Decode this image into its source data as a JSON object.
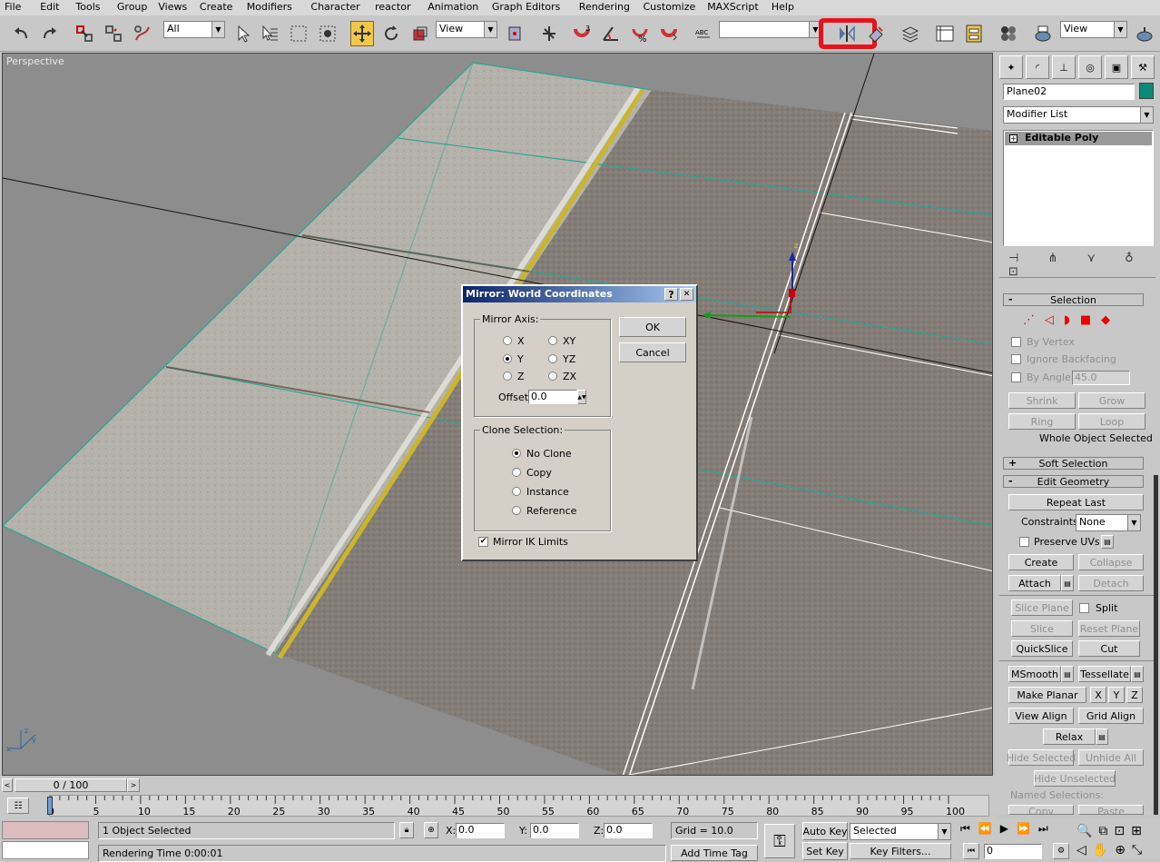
{
  "menu": [
    "File",
    "Edit",
    "Tools",
    "Group",
    "Views",
    "Create",
    "Modifiers",
    "Character",
    "reactor",
    "Animation",
    "Graph Editors",
    "Rendering",
    "Customize",
    "MAXScript",
    "Help"
  ],
  "toolbar": {
    "selection_filter": "All",
    "ref_coord": "View",
    "named_selection": "",
    "render_view": "View"
  },
  "highlight_color": "#e8121c",
  "viewport": {
    "label": "Perspective"
  },
  "dialog": {
    "title": "Mirror: World Coordinates",
    "help": "?",
    "close": "✕",
    "mirror_axis_label": "Mirror Axis:",
    "axes": [
      {
        "label": "X",
        "selected": false
      },
      {
        "label": "Y",
        "selected": true
      },
      {
        "label": "Z",
        "selected": false
      },
      {
        "label": "XY",
        "selected": false
      },
      {
        "label": "YZ",
        "selected": false
      },
      {
        "label": "ZX",
        "selected": false
      }
    ],
    "offset_label": "Offset:",
    "offset_value": "0.0",
    "clone_label": "Clone Selection:",
    "clone_options": [
      {
        "label": "No Clone",
        "selected": true
      },
      {
        "label": "Copy",
        "selected": false
      },
      {
        "label": "Instance",
        "selected": false
      },
      {
        "label": "Reference",
        "selected": false
      }
    ],
    "mirror_ik_label": "Mirror IK Limits",
    "mirror_ik_checked": true,
    "ok": "OK",
    "cancel": "Cancel"
  },
  "panel": {
    "object_name": "Plane02",
    "object_color": "#0a8a78",
    "modifier_list": "Modifier List",
    "stack_item": "Editable Poly",
    "selection_head": "Selection",
    "by_vertex": "By Vertex",
    "ignore_backfacing": "Ignore Backfacing",
    "by_angle": "By Angle:",
    "by_angle_value": "45.0",
    "shrink": "Shrink",
    "grow": "Grow",
    "ring": "Ring",
    "loop": "Loop",
    "whole_object": "Whole Object Selected",
    "soft_selection": "Soft Selection",
    "edit_geometry": "Edit Geometry",
    "repeat_last": "Repeat Last",
    "constraints_label": "Constraints:",
    "constraints_value": "None",
    "preserve_uvs": "Preserve UVs",
    "create": "Create",
    "collapse": "Collapse",
    "attach": "Attach",
    "detach": "Detach",
    "slice_plane": "Slice Plane",
    "split": "Split",
    "slice": "Slice",
    "reset_plane": "Reset Plane",
    "quickslice": "QuickSlice",
    "cut": "Cut",
    "msmooth": "MSmooth",
    "tessellate": "Tessellate",
    "make_planar": "Make Planar",
    "x": "X",
    "y": "Y",
    "z": "Z",
    "view_align": "View Align",
    "grid_align": "Grid Align",
    "relax": "Relax",
    "hide_selected": "Hide Selected",
    "unhide_all": "Unhide All",
    "hide_unselected": "Hide Unselected",
    "named_selections": "Named Selections:",
    "copy": "Copy",
    "paste": "Paste"
  },
  "timeline": {
    "frame": "0 / 100",
    "ticks": [
      "0",
      "5",
      "10",
      "15",
      "20",
      "25",
      "30",
      "35",
      "40",
      "45",
      "50",
      "55",
      "60",
      "65",
      "70",
      "75",
      "80",
      "85",
      "90",
      "95",
      "100"
    ]
  },
  "status": {
    "selected": "1 Object Selected",
    "render_time": "Rendering Time  0:00:01",
    "x_label": "X:",
    "x": "0.0",
    "y_label": "Y:",
    "y": "0.0",
    "z_label": "Z:",
    "z": "0.0",
    "grid": "Grid = 10.0",
    "add_time_tag": "Add Time Tag",
    "auto_key": "Auto Key",
    "set_key": "Set Key",
    "key_mode": "Selected",
    "key_filters": "Key Filters...",
    "current_frame": "0"
  }
}
